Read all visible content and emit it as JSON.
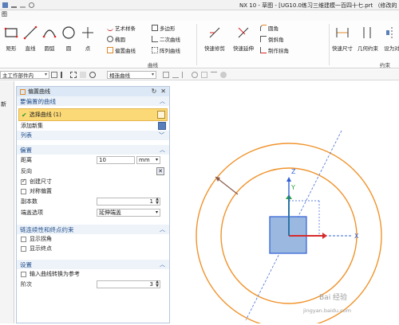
{
  "window": {
    "title": "NX 10 - 草图 - [UG10.0练习三维建模一百四十七.prt （修改的"
  },
  "menubar": {
    "label": "图"
  },
  "ribbon": {
    "tools": {
      "rect": "矩形",
      "line": "直线",
      "arc": "圆弧",
      "circle": "圆",
      "point": "点",
      "art_spline": "艺术样条",
      "ellipse": "椭圆",
      "offset_curve": "偏置曲线",
      "polygon": "多边形",
      "conic": "二次曲线",
      "pattern_curve": "阵列曲线",
      "quick_trim": "快速修剪",
      "quick_extend": "快速延伸",
      "fillet": "圆角",
      "chamfer": "倒斜角",
      "make_corner": "制作拐角",
      "rapid_dimension": "快速尺寸",
      "geometric_constraints": "几何约束",
      "set_as_symmetric": "设为对"
    },
    "groups": {
      "curve": "曲线",
      "constraints": "约束"
    }
  },
  "toolbar2": {
    "work_part_combo": "主工作部件内",
    "filter_combo": "相连曲线"
  },
  "leftstrip": {
    "label": "新"
  },
  "panel": {
    "title": "偏置曲线",
    "sections": {
      "curves": {
        "title": "要偏置的曲线",
        "select_label": "选择曲线 (1)",
        "add_new_set": "添加新集",
        "list_label": "列表"
      },
      "offset": {
        "title": "偏置",
        "distance_label": "距离",
        "distance_value": "10",
        "distance_unit": "mm",
        "reverse_label": "反向",
        "create_dimension": "创建尺寸",
        "symmetric_offset": "对称偏置",
        "copies_label": "副本数",
        "copies_value": "1",
        "cap_options_label": "端盖选项",
        "cap_options_value": "延伸端盖"
      },
      "chain": {
        "title": "链连续性和终点约束",
        "show_corners": "显示拐角",
        "show_endpoints": "显示终点"
      },
      "settings": {
        "title": "设置",
        "convert_to_reference": "输入曲线转换为参考",
        "order_label": "阶次",
        "order_value": "3"
      }
    },
    "checkbox_state": {
      "create_dimension": true,
      "symmetric_offset": false,
      "show_corners": false,
      "show_endpoints": false,
      "convert_to_reference": false
    }
  },
  "viewport": {
    "axis_x": "X",
    "axis_y": "Y",
    "axis_z": "Z"
  },
  "watermark": {
    "brand": "Bai 经验",
    "url": "jingyan.baidu.com"
  },
  "colors": {
    "accent_blue": "#1f4e8c",
    "selection_yellow": "#fcd977",
    "curve_orange": "#f0932b",
    "axis_red": "#d62a2a",
    "axis_green": "#29a33a",
    "axis_blue": "#2f5fd6"
  }
}
